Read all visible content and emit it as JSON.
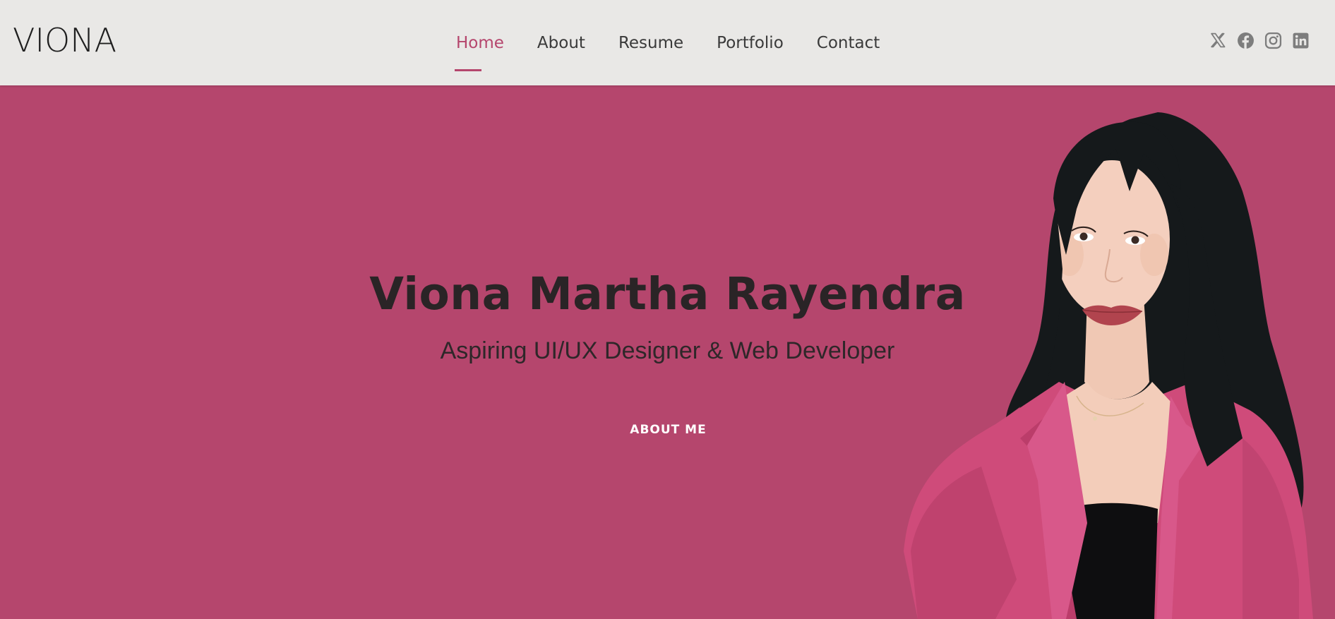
{
  "brand": {
    "logo_text": "VIONA"
  },
  "nav": {
    "items": [
      {
        "label": "Home",
        "active": true
      },
      {
        "label": "About",
        "active": false
      },
      {
        "label": "Resume",
        "active": false
      },
      {
        "label": "Portfolio",
        "active": false
      },
      {
        "label": "Contact",
        "active": false
      }
    ]
  },
  "social": {
    "icons": [
      "x-twitter-icon",
      "facebook-icon",
      "instagram-icon",
      "linkedin-icon"
    ]
  },
  "hero": {
    "name": "Viona Martha Rayendra",
    "subtitle": "Aspiring UI/UX Designer & Web Developer",
    "button_label": "ABOUT ME"
  },
  "colors": {
    "accent": "#b5466d",
    "header_bg": "#e9e8e6",
    "hero_bg": "#b5466d",
    "text_dark": "#2a2426",
    "icon_gray": "#7d7d7d"
  }
}
